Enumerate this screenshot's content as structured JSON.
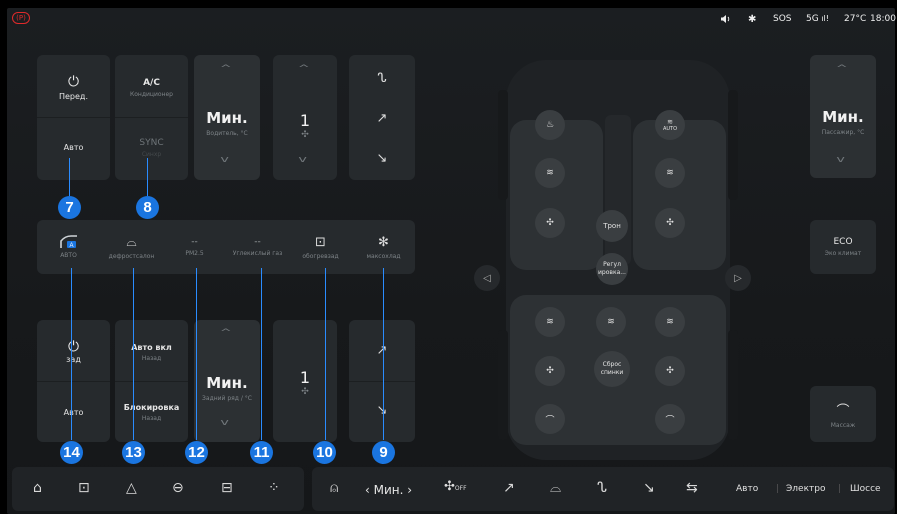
{
  "status_bar": {
    "volume_icon": "volume-icon",
    "bluetooth_icon": "bluetooth-icon",
    "sos": "SOS",
    "signal": "5G",
    "temperature": "27°C",
    "time": "18:00",
    "parking_badge": "(P)"
  },
  "front": {
    "power_label": "Перед.",
    "auto_label": "Авто",
    "ac_label": "A/C",
    "ac_sub": "Кондиционер",
    "sync_label": "SYNC",
    "sync_sub": "Синхр",
    "driver_temp": "Мин.",
    "driver_temp_sub": "Водитель, °C",
    "fan_value": "1"
  },
  "functions": [
    {
      "label": "АВТО",
      "icon": "auto-climate-icon"
    },
    {
      "label": "дефростсалон",
      "icon": "defrost-windshield-icon"
    },
    {
      "label": "PM2.5",
      "value": "--"
    },
    {
      "label": "Углекислый газ",
      "value": "--"
    },
    {
      "label": "обогревзад",
      "icon": "rear-defrost-icon"
    },
    {
      "label": "максохлад",
      "icon": "max-cool-icon"
    }
  ],
  "rear": {
    "power_label": "зад",
    "auto_label": "Авто",
    "auto_on_label": "Авто вкл",
    "auto_on_sub": "Назад",
    "lock_label": "Блокировка",
    "lock_sub": "Назад",
    "temp": "Мин.",
    "temp_sub": "Задний ряд / °C",
    "fan_value": "1"
  },
  "passenger": {
    "temp": "Мин.",
    "temp_sub": "Пассажир, °C",
    "eco_label": "ECO",
    "eco_sub": "Эко климат",
    "massage_label": "Массаж"
  },
  "seat_buttons": {
    "throne": "Трон",
    "adjust": "Регул ировка...",
    "reset": "Сброс спинки",
    "auto_badge": "AUTO"
  },
  "callouts": [
    "7",
    "8",
    "14",
    "13",
    "12",
    "11",
    "10",
    "9"
  ],
  "bottom_bar": {
    "fan_value": "Мин.",
    "fan_off": "OFF",
    "auto": "Авто",
    "electro": "Электро",
    "highway": "Шоссе",
    "separator": "|"
  },
  "colors": {
    "accent": "#1a75e0",
    "background": "#1b1e21",
    "card": "#262a2d",
    "parking": "#e02a2a"
  }
}
